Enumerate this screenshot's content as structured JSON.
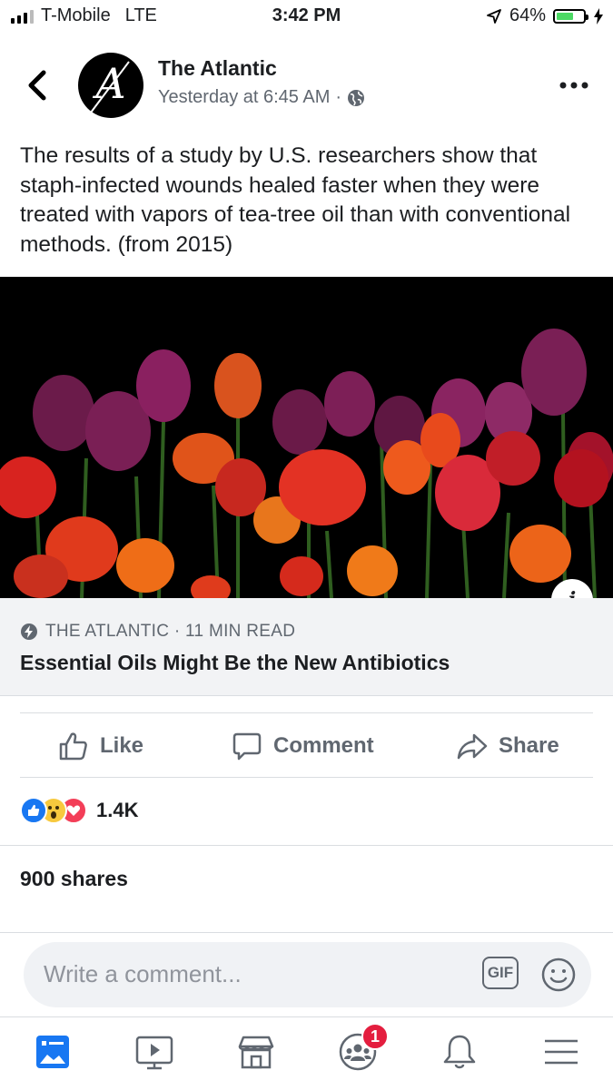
{
  "status_bar": {
    "carrier": "T-Mobile",
    "network": "LTE",
    "time": "3:42 PM",
    "battery": "64%",
    "battery_level": 0.64
  },
  "post": {
    "page_name": "The Atlantic",
    "timestamp": "Yesterday at 6:45 AM",
    "separator": "·",
    "privacy_icon": "globe-icon",
    "text": "The results of a study by U.S. researchers show that staph-infected wounds healed faster when they were treated with vapors of tea-tree oil than with conventional methods. (from 2015)"
  },
  "link_card": {
    "source": "THE ATLANTIC · 11 MIN READ",
    "source_icon": "instant-article-bolt-icon",
    "headline": "Essential Oils Might Be the New Antibiotics"
  },
  "actions": {
    "like": "Like",
    "comment": "Comment",
    "share": "Share"
  },
  "reactions": {
    "types": [
      "like",
      "wow",
      "love"
    ],
    "count": "1.4K"
  },
  "shares": "900 shares",
  "comment_box": {
    "placeholder": "Write a comment...",
    "gif_label": "GIF"
  },
  "tabbar": {
    "tabs": [
      "news-feed-icon",
      "watch-icon",
      "marketplace-icon",
      "groups-icon",
      "notifications-icon",
      "menu-icon"
    ],
    "groups_badge": "1"
  },
  "colors": {
    "accent": "#1877f2",
    "badge": "#e41e3f",
    "text_secondary": "#606770",
    "battery_fill": "#4cd964"
  }
}
